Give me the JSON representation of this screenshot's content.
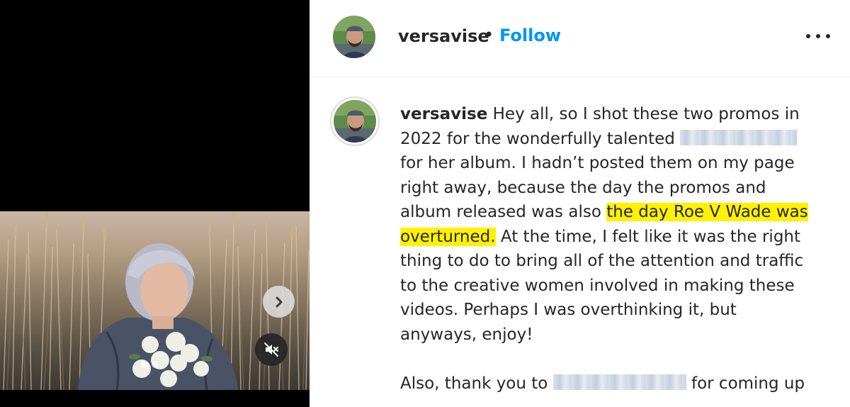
{
  "header": {
    "username": "versavise",
    "separator": "•",
    "follow_label": "Follow",
    "more_icon": "more-horizontal-icon"
  },
  "media": {
    "next_icon": "chevron-right-icon",
    "mute_icon": "speaker-muted-icon",
    "carousel_total": 2,
    "carousel_active": 1
  },
  "caption": {
    "username": "versavise",
    "l1": "Hey all, so I shot these two promos in",
    "l2": "2022 for the wonderfully talented",
    "l3": "for her album. I hadn’t posted them on my page",
    "l4": "right away, because the day the promos and",
    "l5a": "album released was also",
    "l5b": "the day Roe V Wade was",
    "l6a": "overturned.",
    "l6b": "At the time, I felt like it was the right",
    "l7": "thing to do to bring all of the attention and traffic",
    "l8": "to the creative women involved in making these",
    "l9": "videos. Perhaps I was overthinking it, but",
    "l10": "anyways, enjoy!",
    "l11a": "Also, thank you to",
    "l11b": "for coming up"
  },
  "colors": {
    "follow": "#0095f6",
    "highlight": "#fff200",
    "text": "#262626"
  }
}
